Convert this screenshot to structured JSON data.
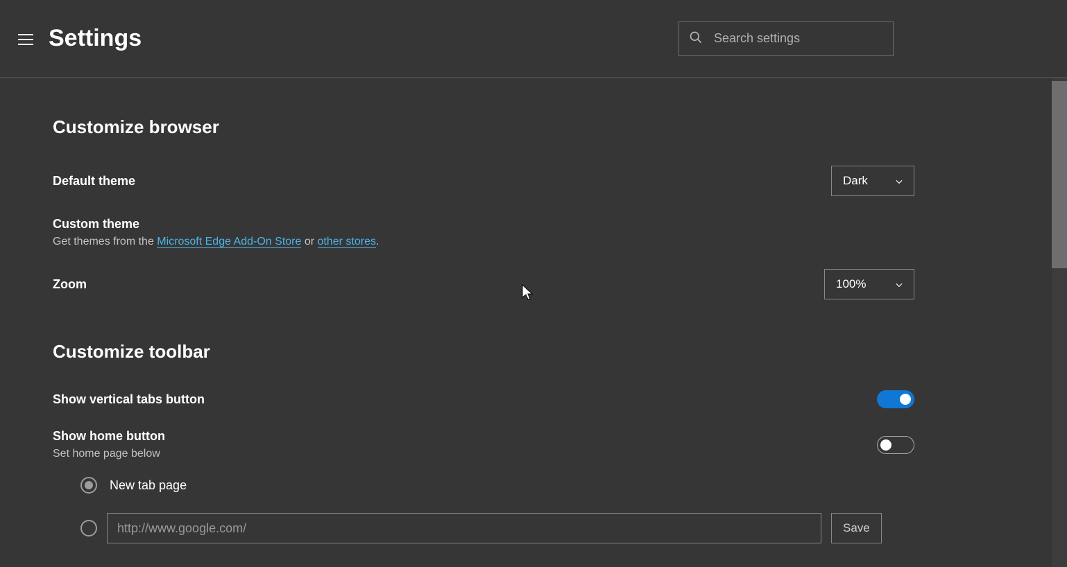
{
  "header": {
    "title": "Settings",
    "search_placeholder": "Search settings"
  },
  "sections": {
    "customize_browser": {
      "title": "Customize browser",
      "default_theme": {
        "label": "Default theme",
        "value": "Dark"
      },
      "custom_theme": {
        "label": "Custom theme",
        "description_prefix": "Get themes from the ",
        "link1": "Microsoft Edge Add-On Store",
        "mid": " or ",
        "link2": "other stores",
        "suffix": "."
      },
      "zoom": {
        "label": "Zoom",
        "value": "100%"
      }
    },
    "customize_toolbar": {
      "title": "Customize toolbar",
      "vertical_tabs": {
        "label": "Show vertical tabs button",
        "enabled": true
      },
      "home_button": {
        "label": "Show home button",
        "sublabel": "Set home page below",
        "enabled": false,
        "radio_new_tab": "New tab page",
        "url_placeholder": "http://www.google.com/",
        "save_label": "Save"
      }
    }
  }
}
